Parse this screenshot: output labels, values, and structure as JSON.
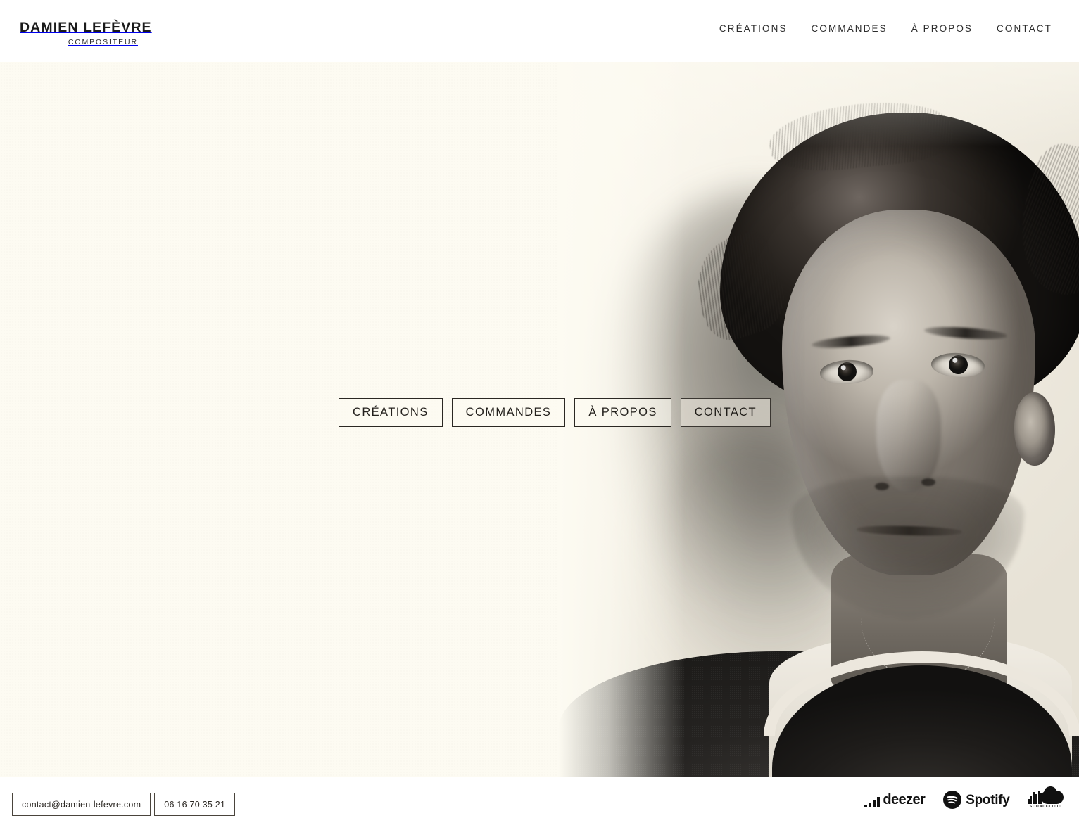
{
  "header": {
    "brand_name": "DAMIEN LEFÈVRE",
    "brand_subtitle": "COMPOSITEUR",
    "nav": [
      {
        "label": "CRÉATIONS"
      },
      {
        "label": "COMMANDES"
      },
      {
        "label": "À PROPOS"
      },
      {
        "label": "CONTACT"
      }
    ]
  },
  "hero": {
    "background_color": "#fdfbf2",
    "portrait_alt": "portrait-photo-damien-lefevre",
    "menu": [
      {
        "label": "CRÉATIONS",
        "over_photo": false
      },
      {
        "label": "COMMANDES",
        "over_photo": false
      },
      {
        "label": "À PROPOS",
        "over_photo": false
      },
      {
        "label": "CONTACT",
        "over_photo": true
      }
    ]
  },
  "footer": {
    "email": "contact@damien-lefevre.com",
    "phone": "06 16 70 35 21",
    "social": [
      {
        "name": "deezer",
        "label": "deezer"
      },
      {
        "name": "spotify",
        "label": "Spotify"
      },
      {
        "name": "soundcloud",
        "label": "SOUNDCLOUD"
      }
    ]
  },
  "colors": {
    "cream": "#fdfbf2",
    "white": "#ffffff",
    "ink": "#24211d",
    "border": "#2b2823"
  }
}
